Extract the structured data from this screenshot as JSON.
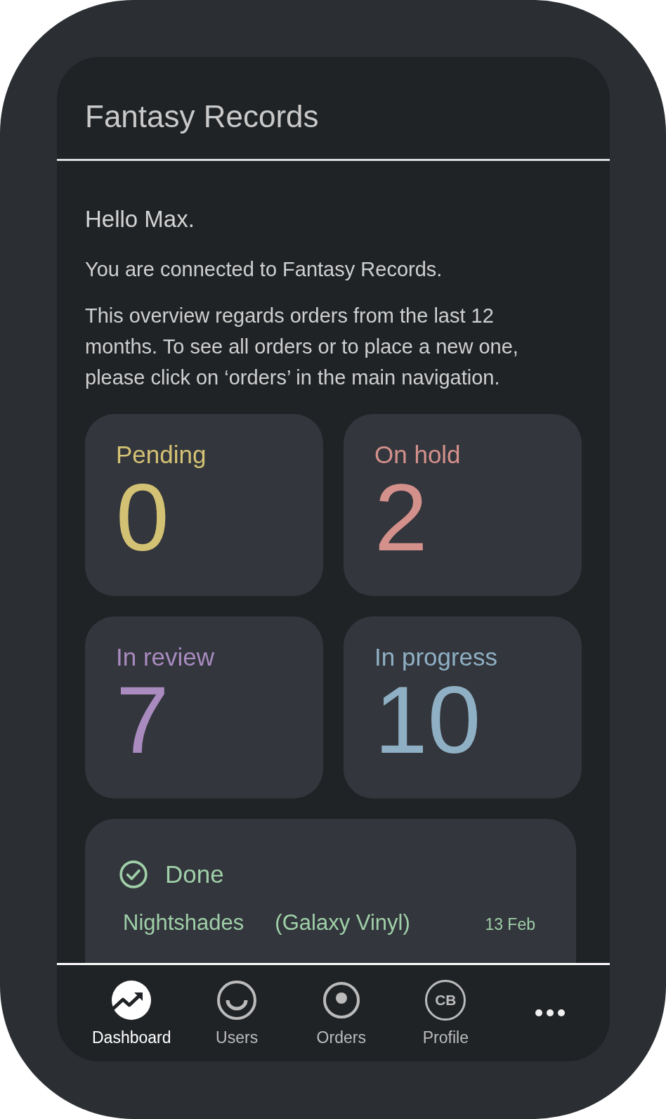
{
  "header": {
    "title": "Fantasy Records"
  },
  "greeting": "Hello Max.",
  "intro": [
    "You are connected to Fantasy Records.",
    "This overview regards orders from the last 12 months. To see all orders or to place a new one, please click on ‘orders’ in the main navigation."
  ],
  "stats": [
    {
      "label": "Pending",
      "count": "0",
      "color": "#d4c274"
    },
    {
      "label": "On hold",
      "count": "2",
      "color": "#d4918c"
    },
    {
      "label": "In review",
      "count": "7",
      "color": "#a98bc0"
    },
    {
      "label": "In progress",
      "count": "10",
      "color": "#8fb0c4"
    }
  ],
  "done": {
    "title": "Done",
    "color": "#9fcfa8",
    "orders": [
      {
        "name": "Nightshades",
        "customer": "(Galaxy Vinyl)",
        "date": "13 Feb"
      }
    ]
  },
  "nav": [
    {
      "kind": "dashboard",
      "label": "Dashboard",
      "selected": true
    },
    {
      "kind": "users",
      "label": "Users",
      "selected": false
    },
    {
      "kind": "orders",
      "label": "Orders",
      "selected": false
    },
    {
      "kind": "profile",
      "label": "Profile",
      "initials": "CB",
      "selected": false
    },
    {
      "kind": "more",
      "selected": false
    }
  ]
}
